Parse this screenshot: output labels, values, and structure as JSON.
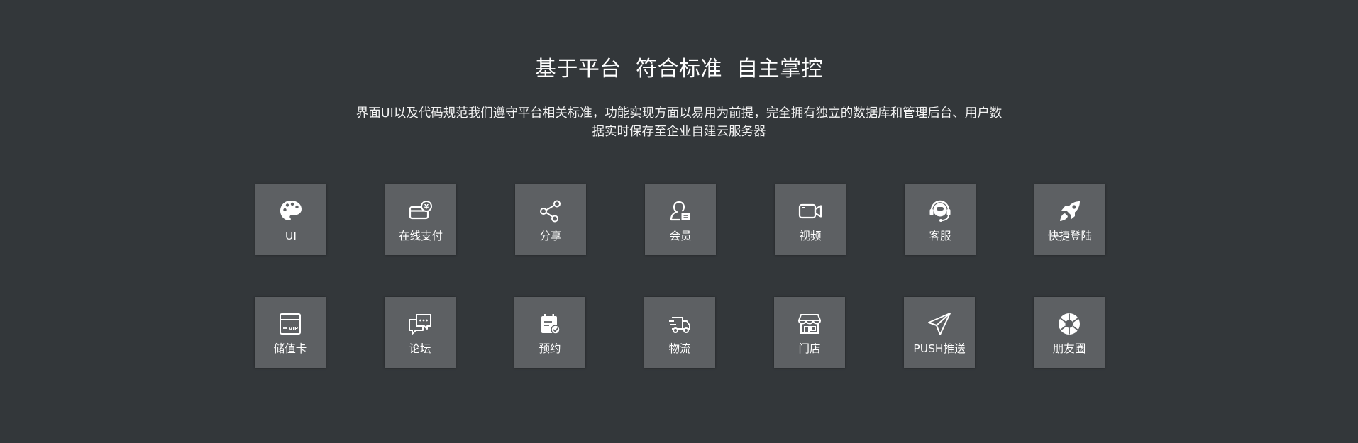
{
  "hero": {
    "title": "基于平台  符合标准  自主掌控",
    "description": "界面UI以及代码规范我们遵守平台相关标准，功能实现方面以易用为前提，完全拥有独立的数据库和管理后台、用户数据实时保存至企业自建云服务器"
  },
  "features": {
    "row1": [
      {
        "label": "UI",
        "icon": "palette-icon"
      },
      {
        "label": "在线支付",
        "icon": "card-payment-icon"
      },
      {
        "label": "分享",
        "icon": "share-icon"
      },
      {
        "label": "会员",
        "icon": "member-icon"
      },
      {
        "label": "视频",
        "icon": "video-camera-icon"
      },
      {
        "label": "客服",
        "icon": "headset-icon"
      },
      {
        "label": "快捷登陆",
        "icon": "rocket-icon"
      }
    ],
    "row2": [
      {
        "label": "储值卡",
        "icon": "vip-card-icon"
      },
      {
        "label": "论坛",
        "icon": "chat-bubbles-icon"
      },
      {
        "label": "预约",
        "icon": "calendar-check-icon"
      },
      {
        "label": "物流",
        "icon": "delivery-truck-icon"
      },
      {
        "label": "门店",
        "icon": "store-icon"
      },
      {
        "label": "PUSH推送",
        "icon": "paper-plane-icon"
      },
      {
        "label": "朋友圈",
        "icon": "aperture-icon"
      }
    ]
  },
  "colors": {
    "background": "#33373a",
    "tile": "#5d6063",
    "text": "#ffffff"
  }
}
